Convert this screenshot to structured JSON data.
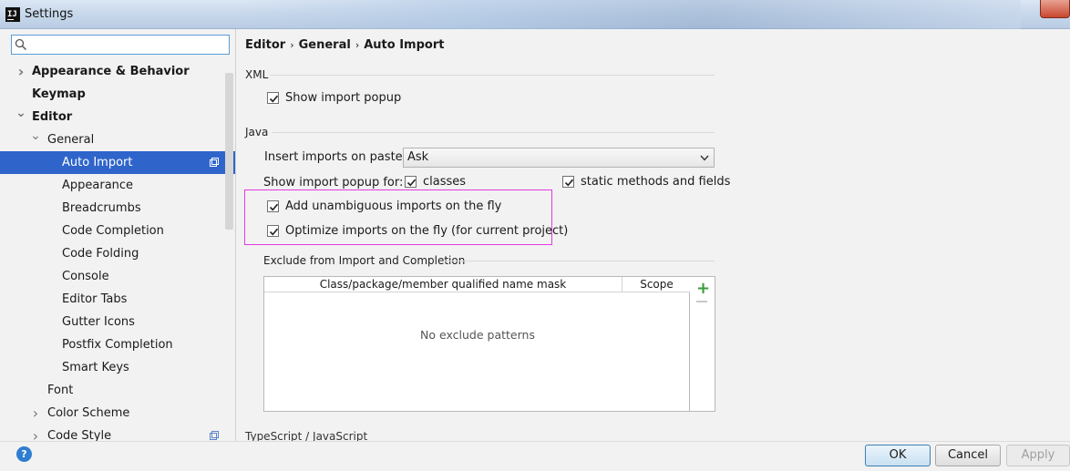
{
  "window": {
    "title": "Settings",
    "app_icon": "intellij-icon"
  },
  "search": {
    "placeholder": ""
  },
  "sidebar": {
    "items": [
      {
        "label": "Appearance & Behavior",
        "level": 0,
        "arrow": "collapsed",
        "bold": true
      },
      {
        "label": "Keymap",
        "level": 0,
        "arrow": "none",
        "bold": true
      },
      {
        "label": "Editor",
        "level": 0,
        "arrow": "expanded",
        "bold": true
      },
      {
        "label": "General",
        "level": 1,
        "arrow": "expanded",
        "bold": false
      },
      {
        "label": "Auto Import",
        "level": 2,
        "arrow": "none",
        "bold": false,
        "selected": true,
        "copy_icon": true
      },
      {
        "label": "Appearance",
        "level": 2,
        "arrow": "none",
        "bold": false
      },
      {
        "label": "Breadcrumbs",
        "level": 2,
        "arrow": "none",
        "bold": false
      },
      {
        "label": "Code Completion",
        "level": 2,
        "arrow": "none",
        "bold": false
      },
      {
        "label": "Code Folding",
        "level": 2,
        "arrow": "none",
        "bold": false
      },
      {
        "label": "Console",
        "level": 2,
        "arrow": "none",
        "bold": false
      },
      {
        "label": "Editor Tabs",
        "level": 2,
        "arrow": "none",
        "bold": false
      },
      {
        "label": "Gutter Icons",
        "level": 2,
        "arrow": "none",
        "bold": false
      },
      {
        "label": "Postfix Completion",
        "level": 2,
        "arrow": "none",
        "bold": false
      },
      {
        "label": "Smart Keys",
        "level": 2,
        "arrow": "none",
        "bold": false
      },
      {
        "label": "Font",
        "level": 1,
        "arrow": "none",
        "bold": false
      },
      {
        "label": "Color Scheme",
        "level": 1,
        "arrow": "collapsed",
        "bold": false
      },
      {
        "label": "Code Style",
        "level": 1,
        "arrow": "collapsed",
        "bold": false,
        "copy_icon": true
      }
    ]
  },
  "breadcrumb": {
    "part1": "Editor",
    "part2": "General",
    "part3": "Auto Import",
    "separator": "›"
  },
  "xml": {
    "section_label": "XML",
    "show_import_popup": {
      "label": "Show import popup",
      "checked": true
    }
  },
  "java": {
    "section_label": "Java",
    "insert_imports_label": "Insert imports on paste:",
    "insert_imports_value": "Ask",
    "show_popup_for_label": "Show import popup for:",
    "classes": {
      "label": "classes",
      "checked": true
    },
    "static_methods": {
      "label": "static methods and fields",
      "checked": true
    },
    "add_unambiguous": {
      "label": "Add unambiguous imports on the fly",
      "checked": true
    },
    "optimize_imports": {
      "label": "Optimize imports on the fly (for current project)",
      "checked": true
    },
    "highlight_color": "#e13be1"
  },
  "exclude": {
    "section_label": "Exclude from Import and Completion",
    "columns": [
      "Class/package/member qualified name mask",
      "Scope"
    ],
    "empty_text": "No exclude patterns",
    "add_icon": "plus-icon",
    "remove_icon": "minus-icon"
  },
  "next_section_label": "TypeScript / JavaScript",
  "footer": {
    "ok": "OK",
    "cancel": "Cancel",
    "apply": "Apply",
    "help": "?"
  },
  "colors": {
    "selection": "#2f65ca",
    "accent": "#5b9bd5"
  }
}
